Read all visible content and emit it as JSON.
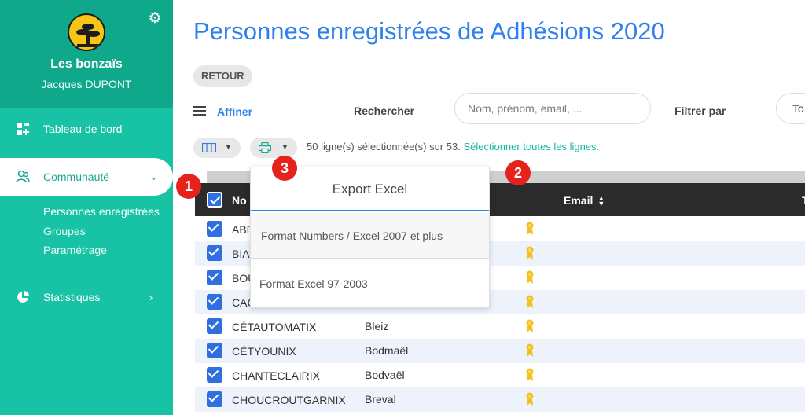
{
  "sidebar": {
    "org_name": "Les bonzaïs",
    "user_name": "Jacques DUPONT",
    "nav": {
      "dashboard": "Tableau de bord",
      "community": "Communauté",
      "statistics": "Statistiques"
    },
    "sub": {
      "persons": "Personnes enregistrées",
      "groups": "Groupes",
      "settings": "Paramétrage"
    }
  },
  "main": {
    "title": "Personnes enregistrées de Adhésions 2020",
    "back_label": "RETOUR",
    "refine_label": "Affiner",
    "search_label": "Rechercher",
    "search_placeholder": "Nom, prénom, email, ...",
    "filter_label": "Filtrer par",
    "filter_value": "To",
    "selection_text": "50 ligne(s) sélectionnée(s) sur 53.",
    "select_all_link": "Sélectionner toutes les lignes."
  },
  "table": {
    "columns": {
      "nom": "No",
      "email": "Email",
      "extra": "T"
    },
    "rows": [
      {
        "nom": "ABR",
        "prenom": "",
        "award": true
      },
      {
        "nom": "BIA",
        "prenom": "",
        "award": true
      },
      {
        "nom": "BOU",
        "prenom": "",
        "award": true
      },
      {
        "nom": "CAC",
        "prenom": "",
        "award": true
      },
      {
        "nom": "CÉTAUTOMATIX",
        "prenom": "Bleiz",
        "award": true
      },
      {
        "nom": "CÉTYOUNIX",
        "prenom": "Bodmaël",
        "award": true
      },
      {
        "nom": "CHANTECLAIRIX",
        "prenom": "Bodvaël",
        "award": true
      },
      {
        "nom": "CHOUCROUTGARNIX",
        "prenom": "Breval",
        "award": true
      }
    ]
  },
  "export_menu": {
    "title": "Export Excel",
    "option1": "Format Numbers / Excel 2007 et plus",
    "option2": "Format Excel 97-2003"
  },
  "annotations": {
    "b1": "1",
    "b2": "2",
    "b3": "3"
  },
  "colors": {
    "sidebar": "#17c3a4",
    "sidebar_top": "#0fa88a",
    "accent_blue": "#2f80ed",
    "badge_red": "#e5221c",
    "header_dark": "#2b2b2b"
  }
}
